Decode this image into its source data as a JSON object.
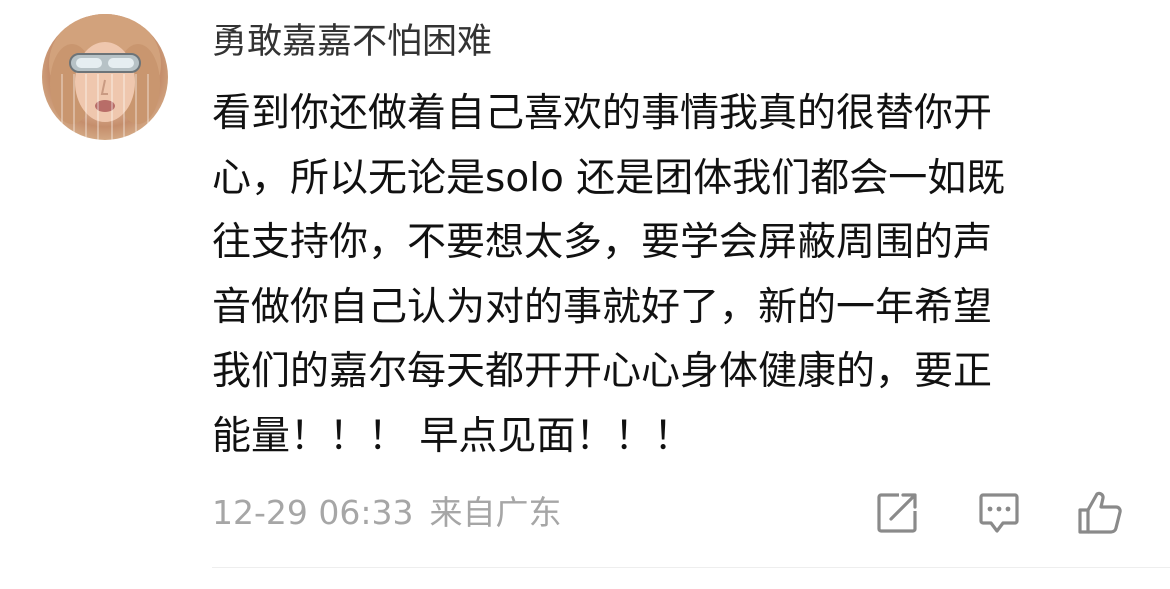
{
  "comment": {
    "username": "勇敢嘉嘉不怕困难",
    "avatar_icon": "user-avatar",
    "body_lines": [
      "看到你还做着自己喜欢的事情我真的很替你开",
      "心，所以无论是solo 还是团体我们都会一如既",
      "往支持你，不要想太多，要学会屏蔽周围的声",
      "音做你自己认为对的事就好了，新的一年希望",
      "我们的嘉尔每天都开开心心身体健康的，要正",
      "能量！！！ 早点见面！！！"
    ],
    "timestamp": "12-29 06:33",
    "location": "来自广东",
    "actions": {
      "share_icon": "share-icon",
      "comment_icon": "comment-icon",
      "like_icon": "thumbs-up-icon"
    },
    "colors": {
      "username": "#333333",
      "body": "#111111",
      "meta": "#a6a6a6",
      "icon": "#8a8a8a"
    }
  }
}
